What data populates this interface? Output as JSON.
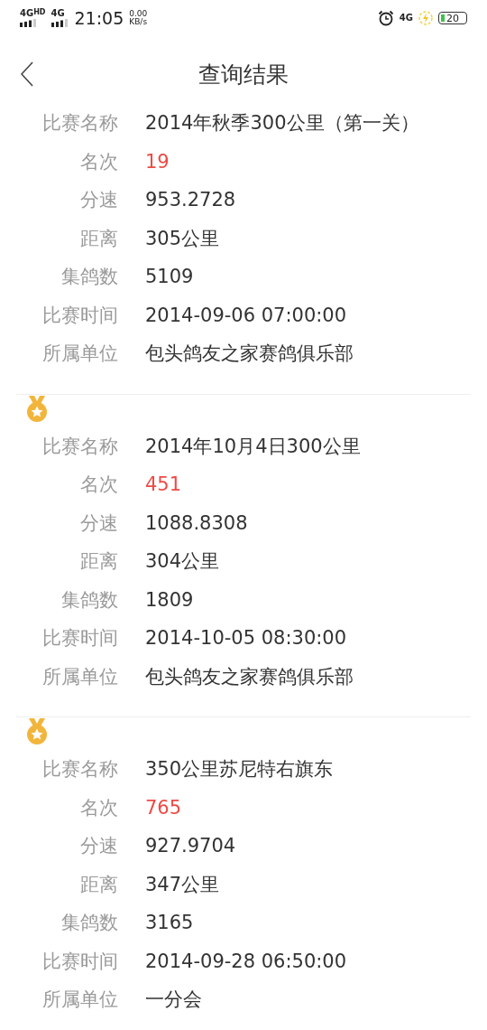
{
  "status_bar": {
    "network_1": "4G",
    "network_1_badge": "HD",
    "network_2": "4G",
    "time": "21:05",
    "speed_value": "0.00",
    "speed_unit": "KB/s",
    "network_3": "4G",
    "battery": "20"
  },
  "header": {
    "title": "查询结果"
  },
  "records": [
    {
      "medal": false,
      "fields": [
        {
          "kind": "text",
          "label": "比赛名称",
          "value": "2014年秋季300公里（第一关）"
        },
        {
          "kind": "rank",
          "label": "名次",
          "value": "19"
        },
        {
          "kind": "text",
          "label": "分速",
          "value": "953.2728"
        },
        {
          "kind": "text",
          "label": "距离",
          "value": "305公里"
        },
        {
          "kind": "text",
          "label": "集鸽数",
          "value": "5109"
        },
        {
          "kind": "text",
          "label": "比赛时间",
          "value": "2014-09-06 07:00:00"
        },
        {
          "kind": "text",
          "label": "所属单位",
          "value": "包头鸽友之家赛鸽俱乐部"
        }
      ]
    },
    {
      "medal": true,
      "fields": [
        {
          "kind": "text",
          "label": "比赛名称",
          "value": "2014年10月4日300公里"
        },
        {
          "kind": "rank",
          "label": "名次",
          "value": "451"
        },
        {
          "kind": "text",
          "label": "分速",
          "value": "1088.8308"
        },
        {
          "kind": "text",
          "label": "距离",
          "value": "304公里"
        },
        {
          "kind": "text",
          "label": "集鸽数",
          "value": "1809"
        },
        {
          "kind": "text",
          "label": "比赛时间",
          "value": "2014-10-05 08:30:00"
        },
        {
          "kind": "text",
          "label": "所属单位",
          "value": "包头鸽友之家赛鸽俱乐部"
        }
      ]
    },
    {
      "medal": true,
      "fields": [
        {
          "kind": "text",
          "label": "比赛名称",
          "value": "350公里苏尼特右旗东"
        },
        {
          "kind": "rank",
          "label": "名次",
          "value": "765"
        },
        {
          "kind": "text",
          "label": "分速",
          "value": "927.9704"
        },
        {
          "kind": "text",
          "label": "距离",
          "value": "347公里"
        },
        {
          "kind": "text",
          "label": "集鸽数",
          "value": "3165"
        },
        {
          "kind": "text",
          "label": "比赛时间",
          "value": "2014-09-28 06:50:00"
        },
        {
          "kind": "text",
          "label": "所属单位",
          "value": "一分会"
        }
      ]
    }
  ]
}
